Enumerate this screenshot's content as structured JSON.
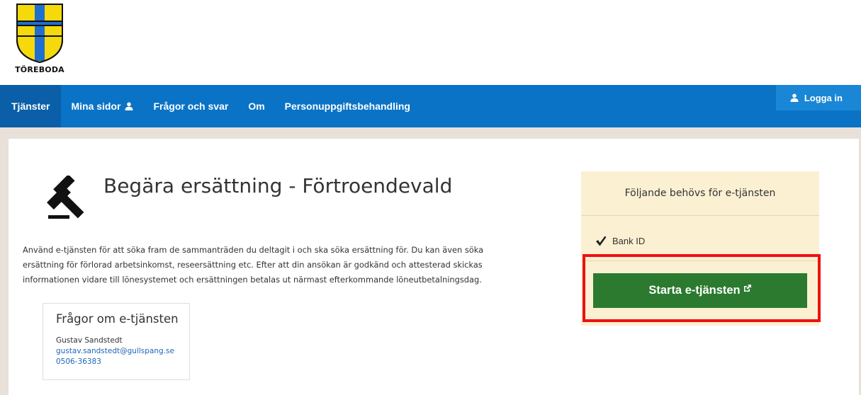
{
  "header": {
    "logo_text": "TÖREBODA",
    "colors": {
      "shield_yellow": "#f5d90a",
      "shield_blue": "#1f6fd0"
    }
  },
  "nav": {
    "items": [
      {
        "label": "Tjänster",
        "active": true
      },
      {
        "label": "Mina sidor"
      },
      {
        "label": "Frågor och svar"
      },
      {
        "label": "Om"
      },
      {
        "label": "Personuppgiftsbehandling"
      }
    ],
    "login_label": "Logga in",
    "colors": {
      "bar": "#0a73c6",
      "active": "#0a5fa8",
      "login": "#1a86d6"
    }
  },
  "service": {
    "title": "Begära ersättning - Förtroendevald",
    "description": "Använd e-tjänsten för att söka fram de sammanträden du deltagit i och ska söka ersättning för. Du kan även söka ersättning för förlorad arbetsinkomst, reseersättning etc. Efter att din ansökan är godkänd och attesterad skickas informationen vidare till lönesystemet och ersättningen betalas ut närmast efterkommande löneutbetalningsdag."
  },
  "contact": {
    "heading": "Frågor om e-tjänsten",
    "name": "Gustav Sandstedt",
    "email": "gustav.sandstedt@gullspang.se",
    "phone": "0506-36383"
  },
  "requirements": {
    "heading": "Följande behövs för e-tjänsten",
    "items": [
      "Bank ID"
    ],
    "start_label": "Starta e-tjänsten",
    "colors": {
      "panel": "#fbf0d2",
      "button": "#2b7a2f",
      "highlight": "#ee1111"
    }
  }
}
